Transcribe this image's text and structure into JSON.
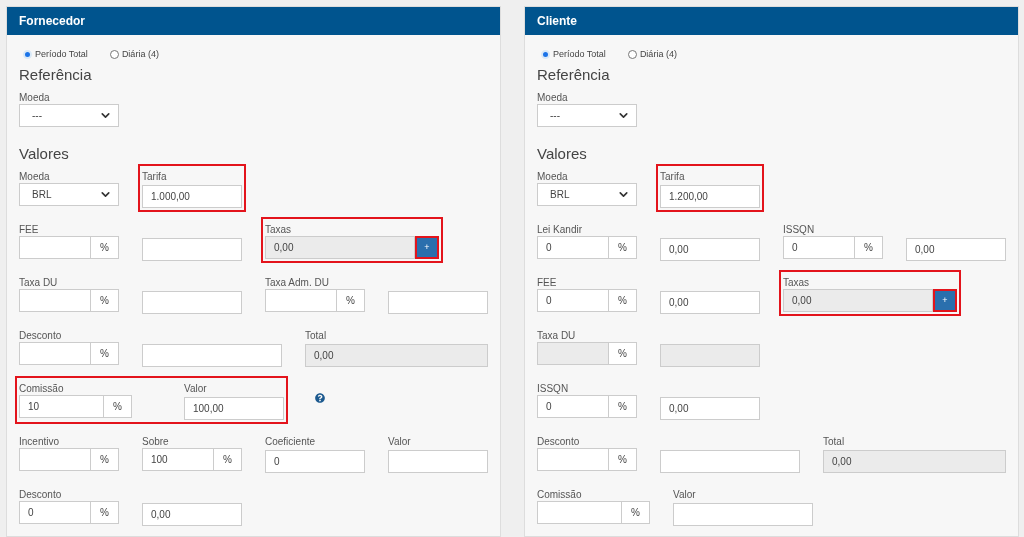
{
  "panels": [
    {
      "title": "Fornecedor",
      "periods": [
        {
          "label": "Período Total",
          "selected": true
        },
        {
          "label": "Diária (4)",
          "selected": false
        }
      ],
      "sections": [
        {
          "heading": "Referência",
          "rows": [
            {
              "fields": [
                {
                  "kind": "select",
                  "label": "Moeda",
                  "value": "---"
                }
              ]
            }
          ]
        },
        {
          "heading": "Valores",
          "rows": [
            {
              "fields": [
                {
                  "kind": "select",
                  "label": "Moeda",
                  "value": "BRL"
                },
                {
                  "kind": "text",
                  "label": "Tarifa",
                  "value": "1.000,00",
                  "highlighted": true
                }
              ]
            },
            {
              "fields": [
                {
                  "kind": "pct",
                  "label": "FEE",
                  "unit": "%"
                },
                {
                  "kind": "text"
                },
                {
                  "kind": "taxas",
                  "label": "Taxas",
                  "value": "0,00",
                  "button": "+",
                  "disabled": true,
                  "highlighted": true
                }
              ]
            },
            {
              "fields": [
                {
                  "kind": "pct",
                  "label": "Taxa DU",
                  "unit": "%"
                },
                {
                  "kind": "text"
                },
                {
                  "kind": "pct",
                  "label": "Taxa Adm. DU",
                  "unit": "%"
                },
                {
                  "kind": "text"
                }
              ]
            },
            {
              "fields": [
                {
                  "kind": "pct",
                  "label": "Desconto",
                  "unit": "%"
                },
                {
                  "kind": "text",
                  "wide": true
                },
                {
                  "kind": "total",
                  "label": "Total",
                  "value": "0,00",
                  "disabled": true
                }
              ]
            },
            {
              "fields": [
                {
                  "kind": "group",
                  "highlighted": true,
                  "fields": [
                    {
                      "kind": "pct",
                      "label": "Comissão",
                      "value": "10",
                      "unit": "%",
                      "wide": true
                    },
                    {
                      "kind": "text",
                      "label": "Valor",
                      "value": "100,00"
                    }
                  ]
                },
                {
                  "kind": "help"
                }
              ]
            },
            {
              "fields": [
                {
                  "kind": "pct",
                  "label": "Incentivo",
                  "unit": "%"
                },
                {
                  "kind": "pct",
                  "label": "Sobre",
                  "value": "100",
                  "unit": "%"
                },
                {
                  "kind": "text",
                  "label": "Coeficiente",
                  "value": "0"
                },
                {
                  "kind": "text",
                  "label": "Valor"
                }
              ]
            },
            {
              "fields": [
                {
                  "kind": "pct",
                  "label": "Desconto",
                  "value": "0",
                  "unit": "%"
                },
                {
                  "kind": "text",
                  "value": "0,00"
                }
              ]
            }
          ]
        }
      ]
    },
    {
      "title": "Cliente",
      "periods": [
        {
          "label": "Período Total",
          "selected": true
        },
        {
          "label": "Diária (4)",
          "selected": false
        }
      ],
      "sections": [
        {
          "heading": "Referência",
          "rows": [
            {
              "fields": [
                {
                  "kind": "select",
                  "label": "Moeda",
                  "value": "---"
                }
              ]
            }
          ]
        },
        {
          "heading": "Valores",
          "rows": [
            {
              "fields": [
                {
                  "kind": "select",
                  "label": "Moeda",
                  "value": "BRL"
                },
                {
                  "kind": "text",
                  "label": "Tarifa",
                  "value": "1.200,00",
                  "highlighted": true
                }
              ]
            },
            {
              "fields": [
                {
                  "kind": "pct",
                  "label": "Lei Kandir",
                  "value": "0",
                  "unit": "%"
                },
                {
                  "kind": "text",
                  "value": "0,00"
                },
                {
                  "kind": "pct",
                  "label": "ISSQN",
                  "value": "0",
                  "unit": "%"
                },
                {
                  "kind": "text",
                  "value": "0,00"
                }
              ]
            },
            {
              "fields": [
                {
                  "kind": "pct",
                  "label": "FEE",
                  "value": "0",
                  "unit": "%"
                },
                {
                  "kind": "text",
                  "value": "0,00"
                },
                {
                  "kind": "taxas",
                  "label": "Taxas",
                  "value": "0,00",
                  "button": "+",
                  "disabled": true,
                  "highlighted": true
                }
              ]
            },
            {
              "fields": [
                {
                  "kind": "pct",
                  "label": "Taxa DU",
                  "unit": "%",
                  "disabled": true
                },
                {
                  "kind": "text",
                  "disabled": true
                }
              ]
            },
            {
              "fields": [
                {
                  "kind": "pct",
                  "label": "ISSQN",
                  "value": "0",
                  "unit": "%"
                },
                {
                  "kind": "text",
                  "value": "0,00"
                }
              ]
            },
            {
              "fields": [
                {
                  "kind": "pct",
                  "label": "Desconto",
                  "unit": "%"
                },
                {
                  "kind": "text",
                  "wide": true
                },
                {
                  "kind": "total",
                  "label": "Total",
                  "value": "0,00",
                  "disabled": true
                }
              ]
            },
            {
              "fields": [
                {
                  "kind": "pct",
                  "label": "Comissão",
                  "unit": "%",
                  "wide": true
                },
                {
                  "kind": "text",
                  "label": "Valor",
                  "wide": true
                }
              ]
            }
          ]
        }
      ]
    }
  ]
}
